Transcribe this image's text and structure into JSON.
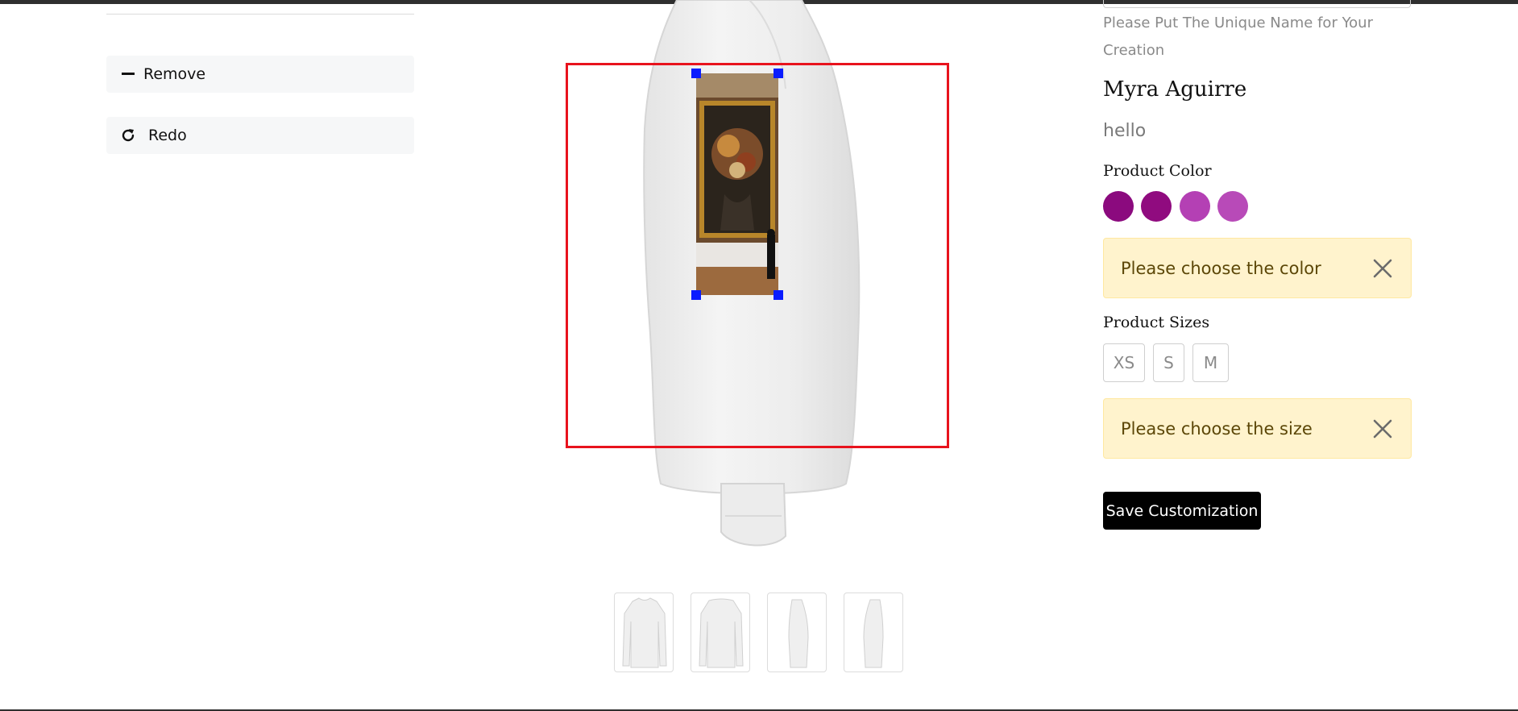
{
  "tools": {
    "remove_label": "Remove",
    "redo_label": "Redo"
  },
  "product": {
    "name_hint": "Please Put The Unique Name for Your Creation",
    "name": "Myra Aguirre",
    "description": "hello",
    "color_label": "Product Color",
    "colors": [
      "#8b0a7e",
      "#900b7f",
      "#b440b4",
      "#b84ab8"
    ],
    "color_alert": "Please choose the color",
    "size_label": "Product Sizes",
    "sizes": [
      "XS",
      "S",
      "M"
    ],
    "size_alert": "Please choose the size",
    "save_label": "Save Customization"
  },
  "colors": {
    "design_area_border": "#e8131d",
    "handle": "#0a1cff",
    "alert_bg": "#fff3cd",
    "save_bg": "#000000"
  },
  "icons": {
    "remove": "minus-icon",
    "redo": "redo-icon",
    "alert_close": "close-icon"
  },
  "thumbnails": [
    "front view",
    "back view",
    "left side view",
    "right side view"
  ]
}
